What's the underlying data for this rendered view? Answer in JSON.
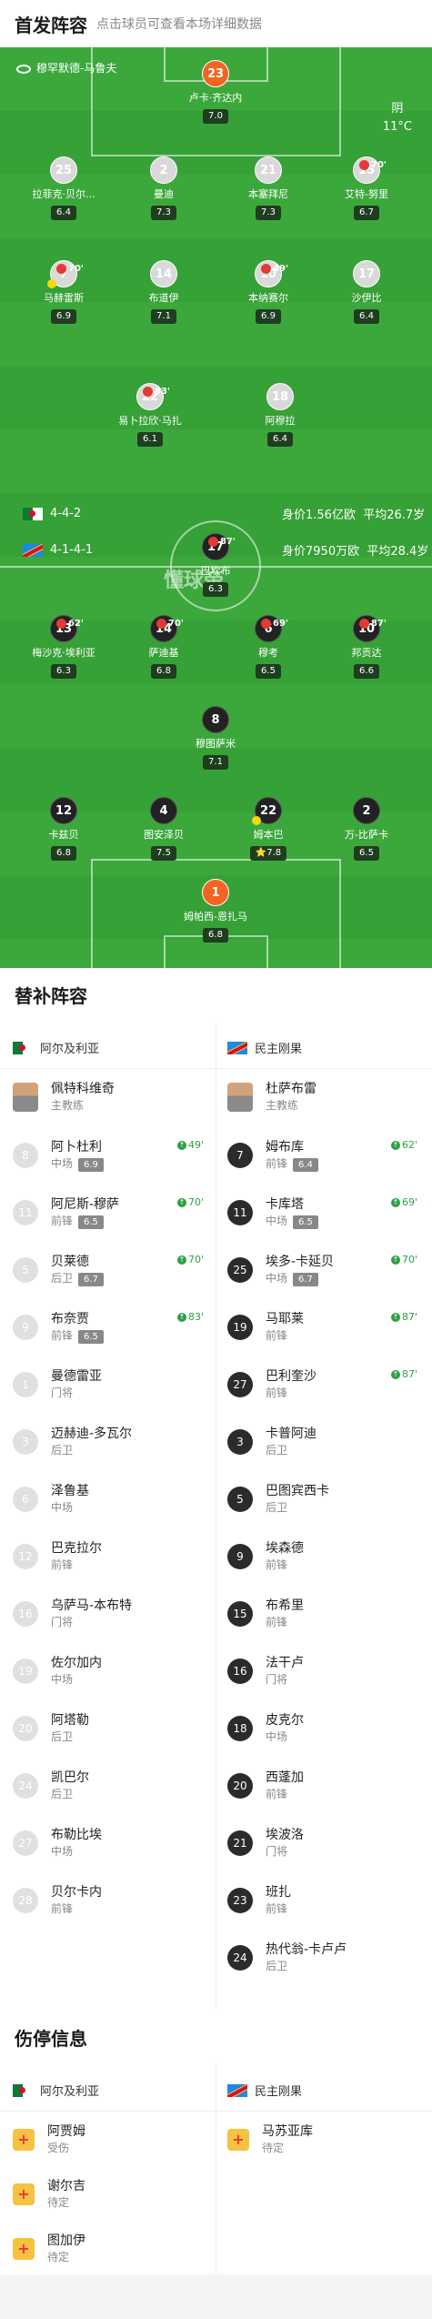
{
  "header": {
    "title": "首发阵容",
    "subtitle": "点击球员可查看本场详细数据"
  },
  "match": {
    "stadium": "穆罕默德-马鲁夫",
    "weather": "阴",
    "temp": "11°C",
    "watermark": "懂球帝"
  },
  "home_team": {
    "name": "阿尔及利亚",
    "formation": "4-4-2",
    "value": "身价1.56亿欧",
    "age": "平均26.7岁"
  },
  "away_team": {
    "name": "民主刚果",
    "formation": "4-1-4-1",
    "value": "身价7950万欧",
    "age": "平均28.4岁"
  },
  "home_players": [
    {
      "num": "23",
      "name": "卢卡·齐达内",
      "rating": "7.0"
    },
    {
      "num": "25",
      "name": "拉菲克·贝尔...",
      "rating": "6.4"
    },
    {
      "num": "2",
      "name": "曼迪",
      "rating": "7.3"
    },
    {
      "num": "21",
      "name": "本塞拜尼",
      "rating": "7.3"
    },
    {
      "num": "15",
      "name": "艾特-努里",
      "rating": "6.7",
      "sub": "70'"
    },
    {
      "num": "7",
      "name": "马赫雷斯",
      "rating": "6.9",
      "sub": "70'"
    },
    {
      "num": "14",
      "name": "布道伊",
      "rating": "7.1"
    },
    {
      "num": "10",
      "name": "本纳赛尔",
      "rating": "6.9",
      "sub": "49'"
    },
    {
      "num": "17",
      "name": "沙伊比",
      "rating": "6.4"
    },
    {
      "num": "22",
      "name": "易卜拉欣·马扎",
      "rating": "6.1",
      "sub": "83'"
    },
    {
      "num": "18",
      "name": "阿穆拉",
      "rating": "6.4"
    }
  ],
  "away_players": [
    {
      "num": "17",
      "name": "巴坎布",
      "rating": "6.3",
      "sub": "87'"
    },
    {
      "num": "13",
      "name": "梅沙克·埃利亚",
      "rating": "6.3",
      "sub": "62'"
    },
    {
      "num": "14",
      "name": "萨迪基",
      "rating": "6.8",
      "sub": "70'"
    },
    {
      "num": "6",
      "name": "穆考",
      "rating": "6.5",
      "sub": "69'"
    },
    {
      "num": "10",
      "name": "邦贡达",
      "rating": "6.6",
      "sub": "87'"
    },
    {
      "num": "8",
      "name": "穆图萨米",
      "rating": "7.1"
    },
    {
      "num": "12",
      "name": "卡兹贝",
      "rating": "6.8"
    },
    {
      "num": "4",
      "name": "图安泽贝",
      "rating": "7.5"
    },
    {
      "num": "22",
      "name": "姆本巴",
      "rating": "7.8",
      "star": "⭐"
    },
    {
      "num": "2",
      "name": "万-比萨卡",
      "rating": "6.5"
    },
    {
      "num": "1",
      "name": "姆帕西-恩扎马",
      "rating": "6.8"
    }
  ],
  "subs_section": {
    "title": "替补阵容"
  },
  "home_coach": {
    "name": "佩特科维奇",
    "role": "主教练"
  },
  "away_coach": {
    "name": "杜萨布雷",
    "role": "主教练"
  },
  "home_subs": [
    {
      "num": "8",
      "name": "阿卜杜利",
      "pos": "中场",
      "rating": "6.9",
      "time": "49'"
    },
    {
      "num": "11",
      "name": "阿尼斯-穆萨",
      "pos": "前锋",
      "rating": "6.5",
      "time": "70'"
    },
    {
      "num": "5",
      "name": "贝莱德",
      "pos": "后卫",
      "rating": "6.7",
      "time": "70'"
    },
    {
      "num": "9",
      "name": "布奈贾",
      "pos": "前锋",
      "rating": "6.5",
      "time": "83'"
    },
    {
      "num": "1",
      "name": "曼德雷亚",
      "pos": "门将"
    },
    {
      "num": "3",
      "name": "迈赫迪-多瓦尔",
      "pos": "后卫"
    },
    {
      "num": "6",
      "name": "泽鲁基",
      "pos": "中场"
    },
    {
      "num": "12",
      "name": "巴克拉尔",
      "pos": "前锋"
    },
    {
      "num": "16",
      "name": "乌萨马-本布特",
      "pos": "门将"
    },
    {
      "num": "19",
      "name": "佐尔加内",
      "pos": "中场"
    },
    {
      "num": "20",
      "name": "阿塔勒",
      "pos": "后卫"
    },
    {
      "num": "24",
      "name": "凯巴尔",
      "pos": "后卫"
    },
    {
      "num": "27",
      "name": "布勒比埃",
      "pos": "中场"
    },
    {
      "num": "28",
      "name": "贝尔卡内",
      "pos": "前锋"
    }
  ],
  "away_subs": [
    {
      "num": "7",
      "name": "姆布库",
      "pos": "前锋",
      "rating": "6.4",
      "time": "62'"
    },
    {
      "num": "11",
      "name": "卡库塔",
      "pos": "中场",
      "rating": "6.5",
      "time": "69'"
    },
    {
      "num": "25",
      "name": "埃多-卡延贝",
      "pos": "中场",
      "rating": "6.7",
      "time": "70'"
    },
    {
      "num": "19",
      "name": "马耶莱",
      "pos": "前锋",
      "time": "87'"
    },
    {
      "num": "27",
      "name": "巴利奎沙",
      "pos": "前锋",
      "time": "87'"
    },
    {
      "num": "3",
      "name": "卡普阿迪",
      "pos": "后卫"
    },
    {
      "num": "5",
      "name": "巴图宾西卡",
      "pos": "后卫"
    },
    {
      "num": "9",
      "name": "埃森德",
      "pos": "前锋"
    },
    {
      "num": "15",
      "name": "布希里",
      "pos": "前锋"
    },
    {
      "num": "16",
      "name": "法干卢",
      "pos": "门将"
    },
    {
      "num": "18",
      "name": "皮克尔",
      "pos": "中场"
    },
    {
      "num": "20",
      "name": "西蓬加",
      "pos": "前锋"
    },
    {
      "num": "21",
      "name": "埃波洛",
      "pos": "门将"
    },
    {
      "num": "23",
      "name": "班扎",
      "pos": "前锋"
    },
    {
      "num": "24",
      "name": "热代翁-卡卢卢",
      "pos": "后卫"
    }
  ],
  "injury_section": {
    "title": "伤停信息"
  },
  "home_injuries": [
    {
      "name": "阿贾姆",
      "status": "受伤"
    },
    {
      "name": "谢尔吉",
      "status": "待定"
    },
    {
      "name": "图加伊",
      "status": "待定"
    }
  ],
  "away_injuries": [
    {
      "name": "马苏亚库",
      "status": "待定"
    }
  ],
  "colors": {
    "pitch": "#3ca83c",
    "gk": "#f26522",
    "sub_in": "#2ea043",
    "sub_out": "#e53935"
  }
}
